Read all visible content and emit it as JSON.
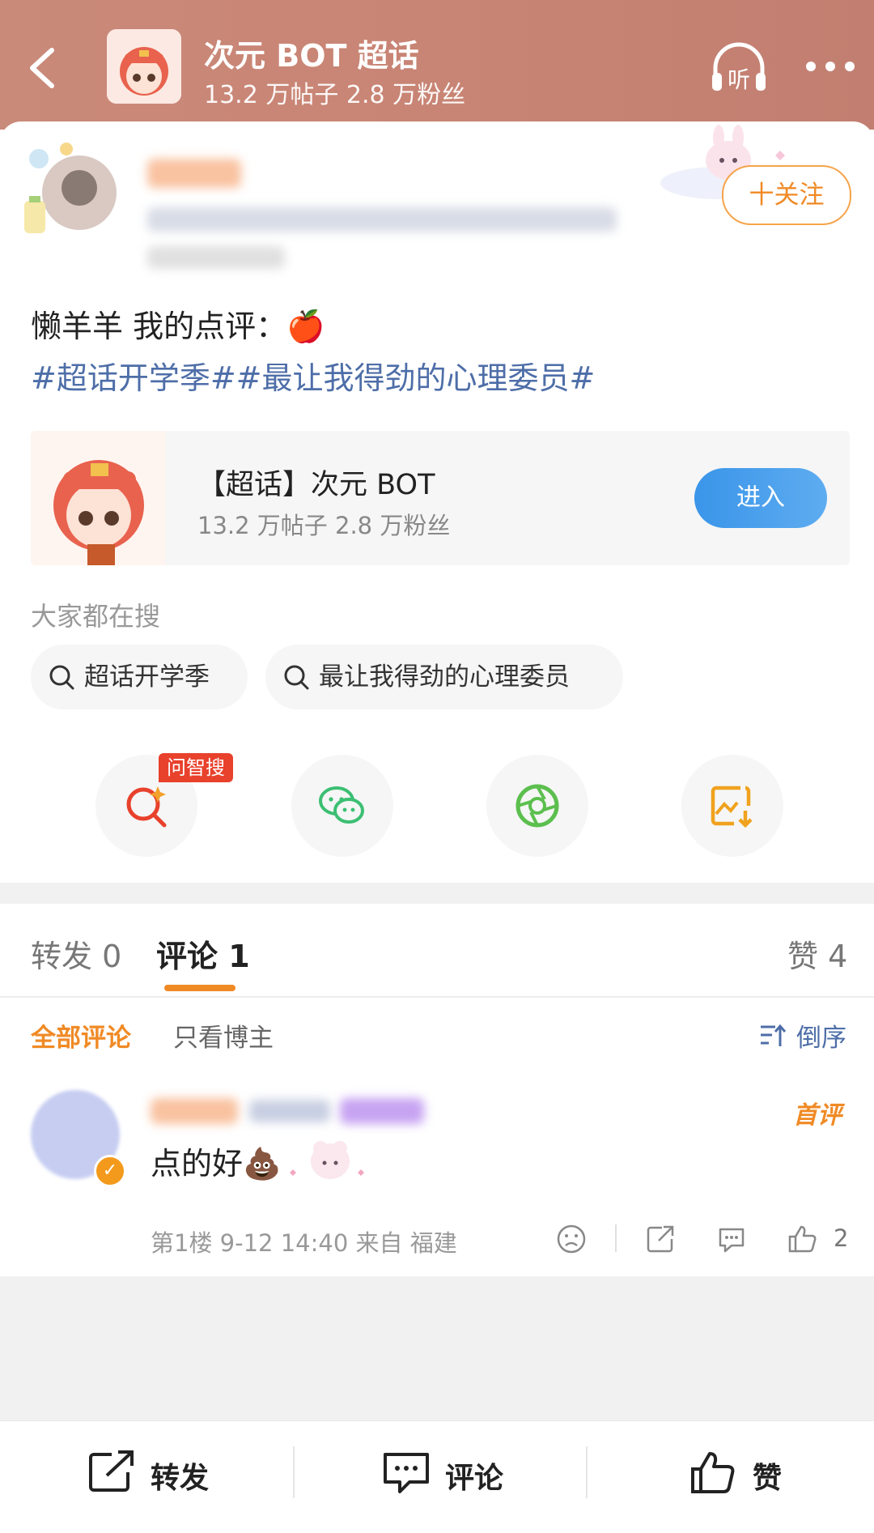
{
  "header": {
    "title": "次元 BOT 超话",
    "subtitle": "13.2 万帖子 2.8 万粉丝",
    "listen_label": "听"
  },
  "post": {
    "follow_label": "十关注",
    "text": "懒羊羊 我的点评：🍎",
    "tags": "#超话开学季##最让我得劲的心理委员#"
  },
  "topic_card": {
    "title": "【超话】次元 BOT",
    "subtitle": "13.2 万帖子 2.8 万粉丝",
    "enter_label": "进入"
  },
  "search": {
    "label": "大家都在搜",
    "chips": [
      "超话开学季",
      "最让我得劲的心理委员"
    ]
  },
  "share": {
    "badge": "问智搜",
    "icons": [
      "ai-search-icon",
      "wechat-icon",
      "moments-icon",
      "save-image-icon"
    ]
  },
  "tabs": {
    "repost": "转发 0",
    "comment": "评论 1",
    "like": "赞 4"
  },
  "filters": {
    "all": "全部评论",
    "owner": "只看博主",
    "sort": "倒序"
  },
  "comment": {
    "badge": "首评",
    "text": "点的好💩",
    "meta": "第1楼 9-12 14:40 来自 福建",
    "like_count": "2"
  },
  "bottom_bar": {
    "repost": "转发",
    "comment": "评论",
    "like": "赞"
  },
  "colors": {
    "accent": "#f08a25",
    "link": "#4e6ea8",
    "enter_button": "#3a95e9"
  }
}
